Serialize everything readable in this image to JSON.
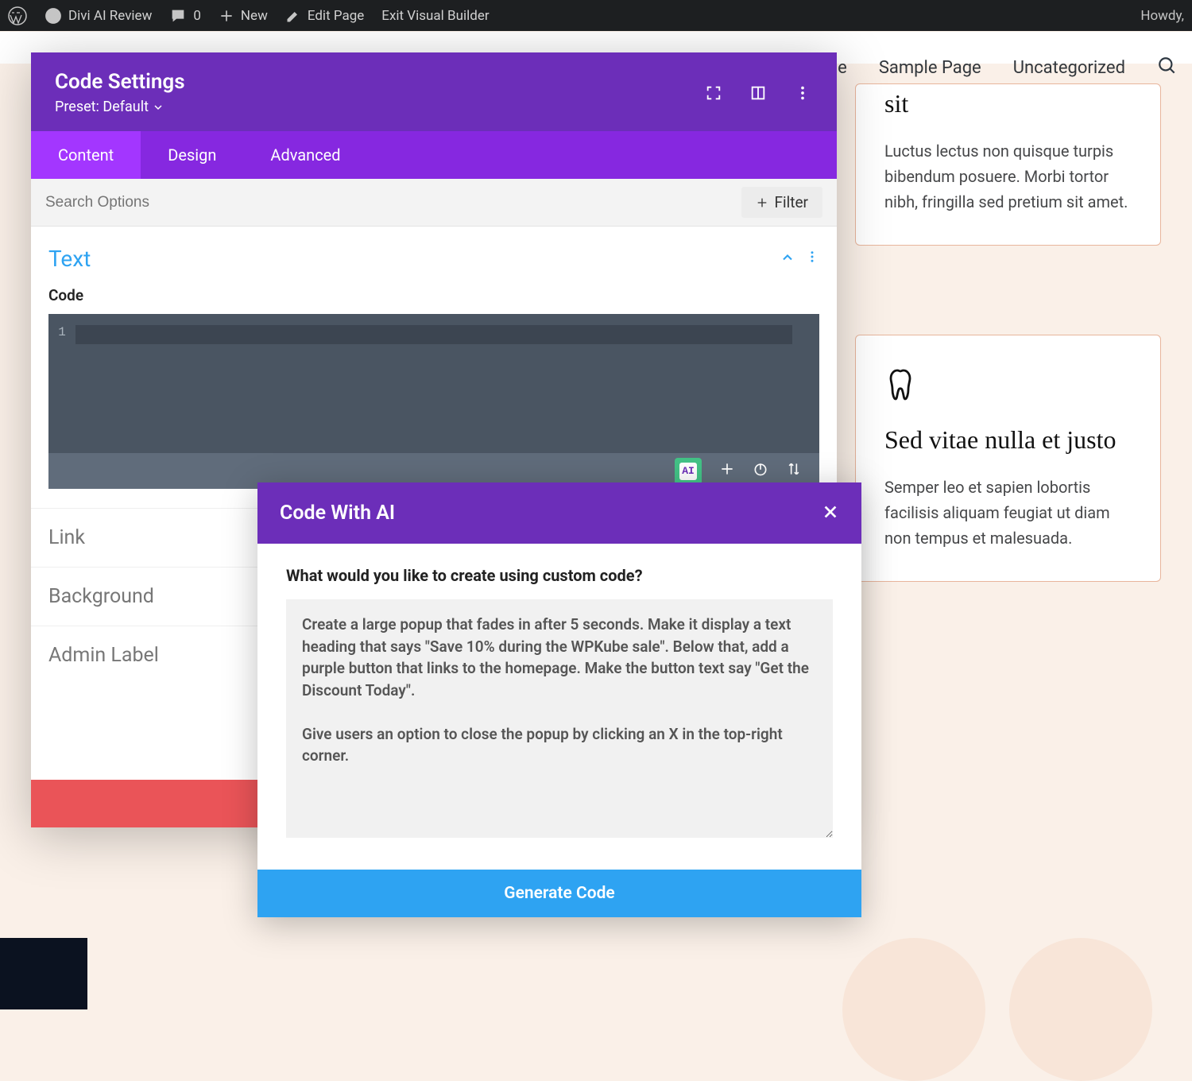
{
  "adminbar": {
    "site_title": "Divi AI Review",
    "comments_count": "0",
    "new_label": "New",
    "edit_page": "Edit Page",
    "exit_vb": "Exit Visual Builder",
    "greeting": "Howdy,"
  },
  "page_nav": {
    "item1_suffix": "ple",
    "item2": "Sample Page",
    "item3": "Uncategorized"
  },
  "cards": {
    "card1": {
      "heading_fragment": "sit",
      "body": "Luctus lectus non quisque turpis bibendum posuere. Morbi tortor nibh, fringilla sed pretium sit amet."
    },
    "card2": {
      "heading": "Sed vitae nulla et justo",
      "body": "Semper leo et sapien lobortis facilisis aliquam feugiat ut diam non tempus et malesuada."
    }
  },
  "modal": {
    "title": "Code Settings",
    "preset": "Preset: Default",
    "tabs": {
      "content": "Content",
      "design": "Design",
      "advanced": "Advanced"
    },
    "search_placeholder": "Search Options",
    "filter_label": "Filter",
    "text_section": {
      "title": "Text",
      "code_label": "Code",
      "line": "1"
    },
    "accordion": {
      "link": "Link",
      "background": "Background",
      "admin_label": "Admin Label"
    },
    "ai_badge": "AI"
  },
  "ai_popup": {
    "title": "Code With AI",
    "question": "What would you like to create using custom code?",
    "textarea_value": "Create a large popup that fades in after 5 seconds. Make it display a text heading that says \"Save 10% during the WPKube sale\". Below that, add a purple button that links to the homepage. Make the button text say \"Get the Discount Today\".\n\nGive users an option to close the popup by clicking an X in the top-right corner.",
    "generate": "Generate Code"
  }
}
